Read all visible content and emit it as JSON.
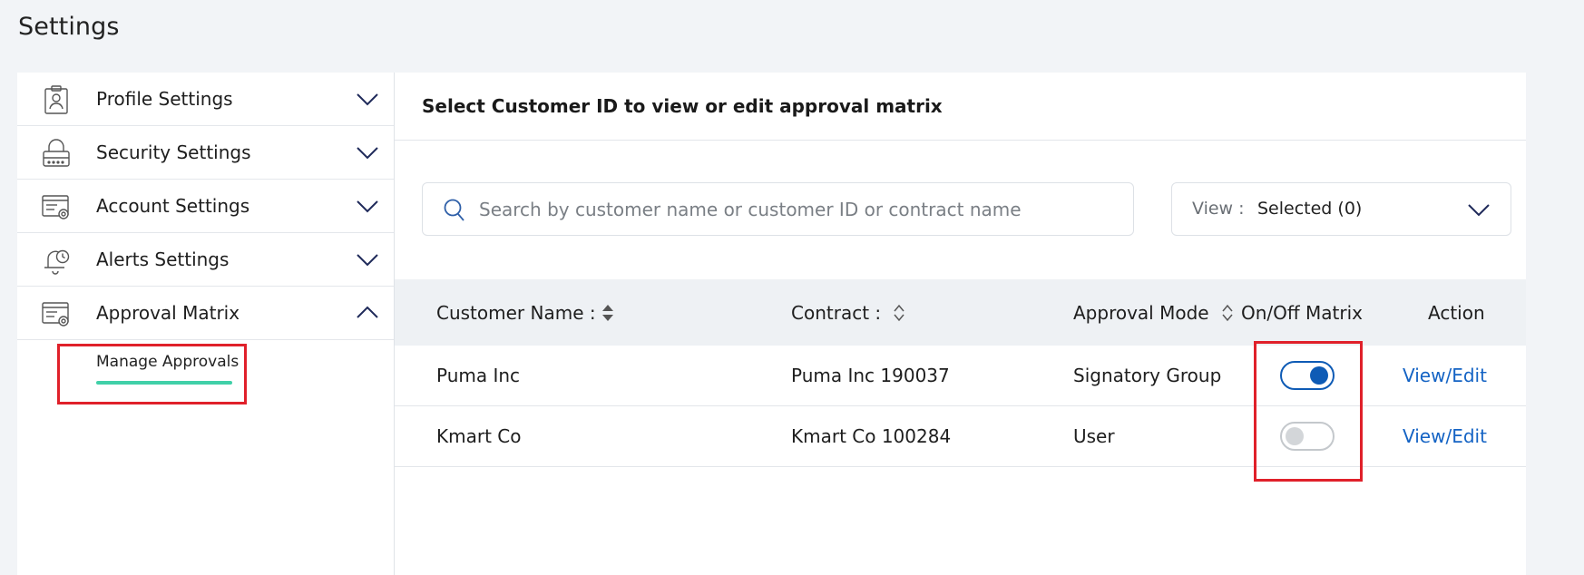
{
  "page": {
    "title": "Settings"
  },
  "sidebar": {
    "items": [
      {
        "label": "Profile Settings",
        "icon": "profile-badge-icon",
        "expanded": false
      },
      {
        "label": "Security Settings",
        "icon": "lock-icon",
        "expanded": false
      },
      {
        "label": "Account Settings",
        "icon": "account-settings-icon",
        "expanded": false
      },
      {
        "label": "Alerts Settings",
        "icon": "bell-clock-icon",
        "expanded": false
      },
      {
        "label": "Approval Matrix",
        "icon": "approval-settings-icon",
        "expanded": true
      }
    ],
    "subitem": {
      "label": "Manage Approvals",
      "active": true
    }
  },
  "main": {
    "title": "Select Customer ID to view or edit approval matrix",
    "search": {
      "placeholder": "Search by customer name or customer ID or contract name",
      "value": ""
    },
    "view": {
      "label": "View :",
      "value": "Selected (0)"
    },
    "table": {
      "columns": [
        "Customer Name :",
        "Contract :",
        "Approval Mode",
        "On/Off Matrix",
        "Action"
      ],
      "rows": [
        {
          "customer": "Puma Inc",
          "contract": "Puma Inc 190037",
          "mode": "Signatory Group",
          "matrix_on": true,
          "action": "View/Edit"
        },
        {
          "customer": "Kmart Co",
          "contract": "Kmart Co 100284",
          "mode": "User",
          "matrix_on": false,
          "action": "View/Edit"
        }
      ]
    }
  },
  "colors": {
    "accent": "#0e5bb5",
    "link": "#1463c4",
    "highlight": "#e0202a",
    "active_underline": "#40d0a8"
  }
}
